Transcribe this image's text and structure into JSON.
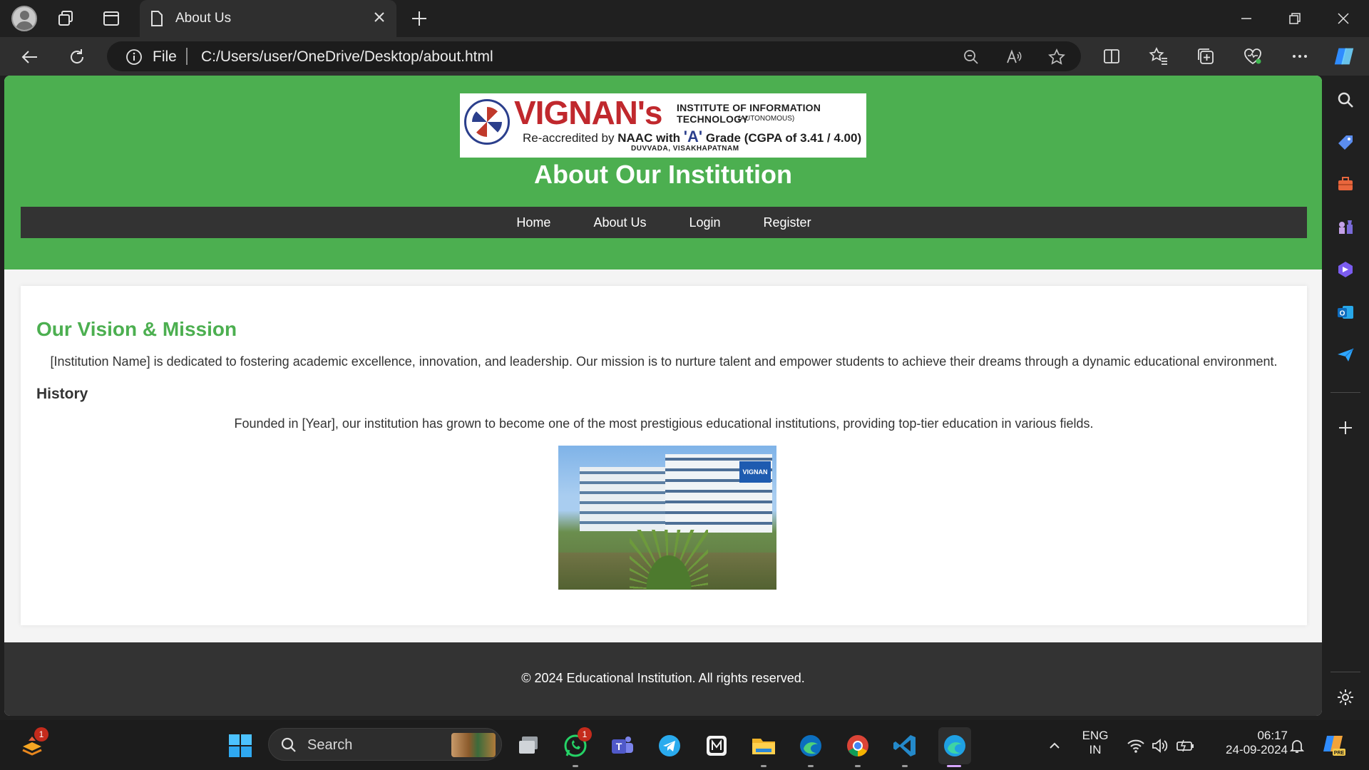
{
  "browser": {
    "tab_title": "About Us",
    "address_scheme": "File",
    "address_url": "C:/Users/user/OneDrive/Desktop/about.html"
  },
  "page": {
    "logo": {
      "brand": "VIGNAN's",
      "institute": "INSTITUTE OF INFORMATION TECHNOLOGY",
      "autonomous": "(AUTONOMOUS)",
      "accreditation_prefix": "Re-accredited by ",
      "accreditation_naac": "NAAC",
      "accreditation_with": " with ",
      "accreditation_grade": "'A'",
      "accreditation_suffix": " Grade (CGPA of 3.41 / 4.00)",
      "location": "DUVVADA, VISAKHAPATNAM"
    },
    "title": "About Our Institution",
    "nav": [
      {
        "label": "Home"
      },
      {
        "label": "About Us"
      },
      {
        "label": "Login"
      },
      {
        "label": "Register"
      }
    ],
    "vision_title": "Our Vision & Mission",
    "vision_text": "[Institution Name] is dedicated to fostering academic excellence, innovation, and leadership. Our mission is to nurture talent and empower students to achieve their dreams through a dynamic educational environment.",
    "history_title": "History",
    "history_text": "Founded in [Year], our institution has grown to become one of the most prestigious educational institutions, providing top-tier education in various fields.",
    "campus_sign": "VIGNAN",
    "footer": "© 2024 Educational Institution. All rights reserved."
  },
  "taskbar": {
    "search_label": "Search",
    "notification_badge": "1",
    "whatsapp_badge": "1",
    "language_top": "ENG",
    "language_bottom": "IN",
    "time": "06:17",
    "date": "24-09-2024"
  },
  "colors": {
    "header_green": "#4caf50",
    "nav_dark": "#333333",
    "chrome_dark": "#202020"
  }
}
